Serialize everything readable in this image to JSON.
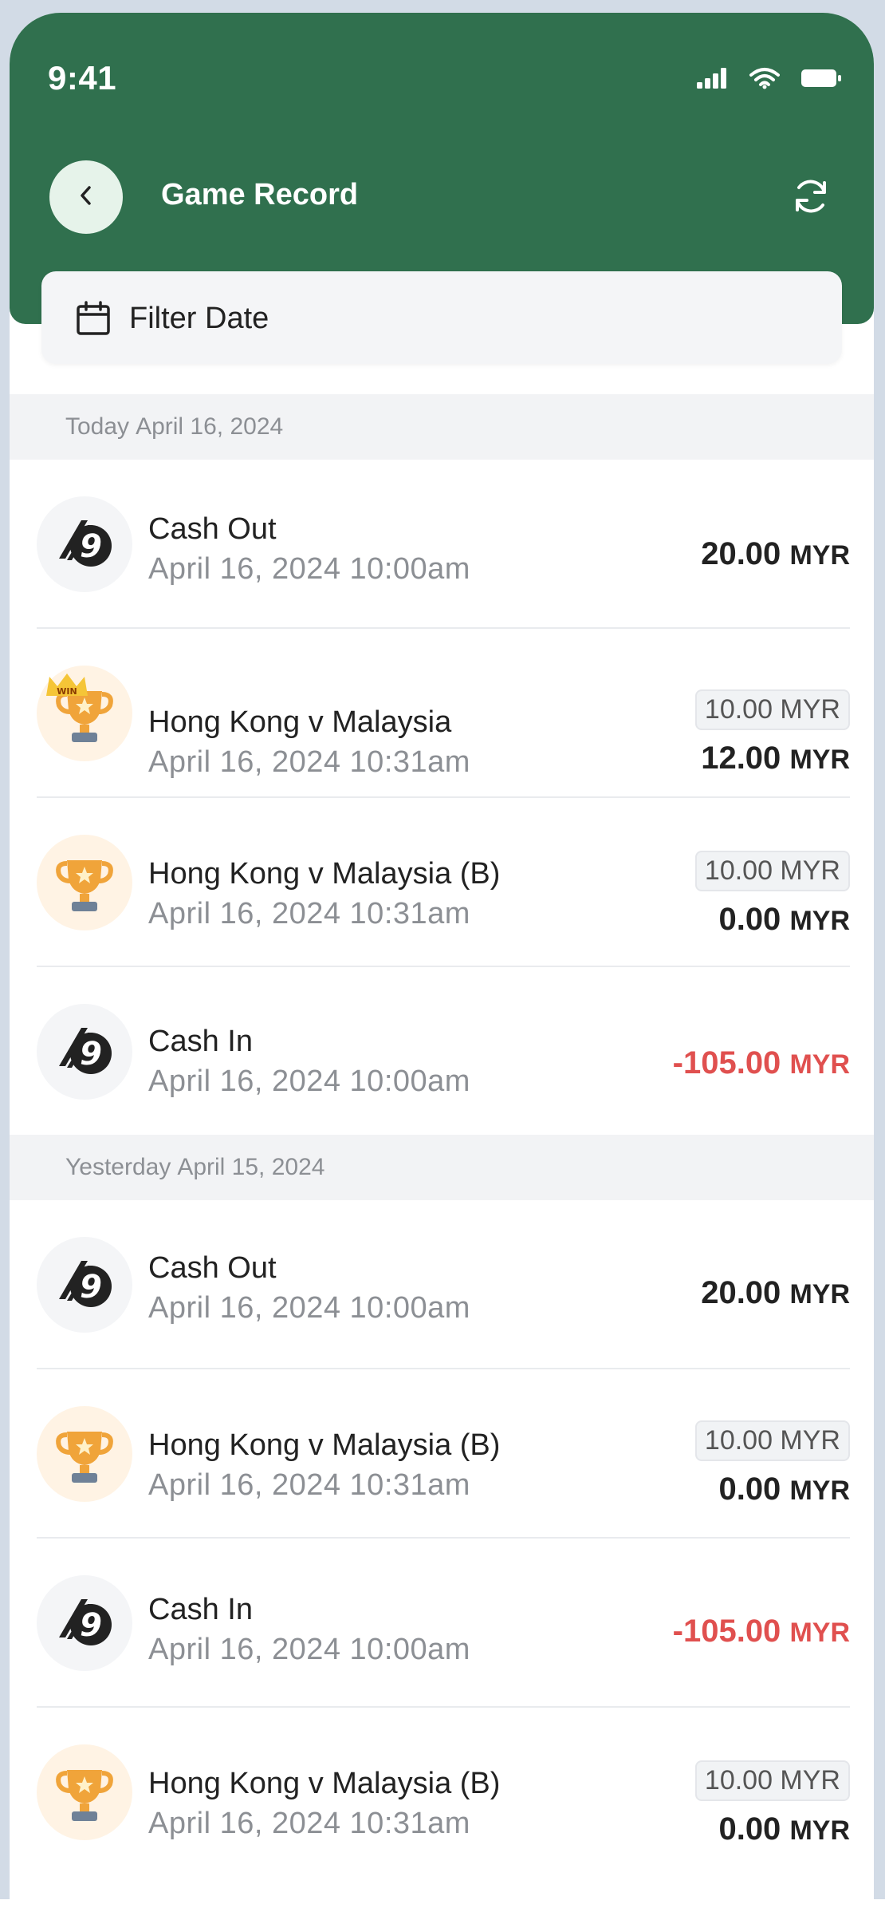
{
  "status_bar": {
    "time": "9:41",
    "icons": [
      "signal-icon",
      "wifi-icon",
      "battery-icon"
    ]
  },
  "navbar": {
    "title": "Game Record",
    "back_icon": "chevron-left-icon",
    "refresh_icon": "refresh-icon"
  },
  "filter": {
    "label": "Filter Date",
    "icon": "calendar-icon"
  },
  "sections": [
    {
      "label": "Today",
      "date": "April 16, 2024",
      "rows": [
        {
          "type": "cash",
          "title": "Cash Out",
          "datetime": "April 16, 2024  10:00am",
          "amount": "20.00",
          "currency": "MYR",
          "negative": false
        },
        {
          "type": "trophy",
          "win": true,
          "win_label": "WIN",
          "title": "Hong Kong v Malaysia",
          "datetime": "April 16, 2024  10:31am",
          "stake": "10.00 MYR",
          "amount": "12.00",
          "currency": "MYR",
          "negative": false
        },
        {
          "type": "trophy",
          "win": false,
          "title": "Hong Kong v Malaysia (B)",
          "datetime": "April 16, 2024  10:31am",
          "stake": "10.00 MYR",
          "amount": "0.00",
          "currency": "MYR",
          "negative": false
        },
        {
          "type": "cash",
          "title": "Cash In",
          "datetime": "April 16, 2024  10:00am",
          "amount": "-105.00",
          "currency": "MYR",
          "negative": true
        }
      ]
    },
    {
      "label": "Yesterday",
      "date": "April 15, 2024",
      "rows": [
        {
          "type": "cash",
          "title": "Cash Out",
          "datetime": "April 16, 2024  10:00am",
          "amount": "20.00",
          "currency": "MYR",
          "negative": false
        },
        {
          "type": "trophy",
          "win": false,
          "title": "Hong Kong v Malaysia (B)",
          "datetime": "April 16, 2024  10:31am",
          "stake": "10.00 MYR",
          "amount": "0.00",
          "currency": "MYR",
          "negative": false
        },
        {
          "type": "cash",
          "title": "Cash In",
          "datetime": "April 16, 2024  10:00am",
          "amount": "-105.00",
          "currency": "MYR",
          "negative": true
        },
        {
          "type": "trophy",
          "win": false,
          "title": "Hong Kong v Malaysia (B)",
          "datetime": "April 16, 2024  10:31am",
          "stake": "10.00 MYR",
          "amount": "0.00",
          "currency": "MYR",
          "negative": false
        }
      ]
    }
  ],
  "colors": {
    "header_green": "#30704e",
    "negative_red": "#e0504f",
    "back_button_bg": "#e6f3ea",
    "trophy_gold": "#f0a43a"
  }
}
